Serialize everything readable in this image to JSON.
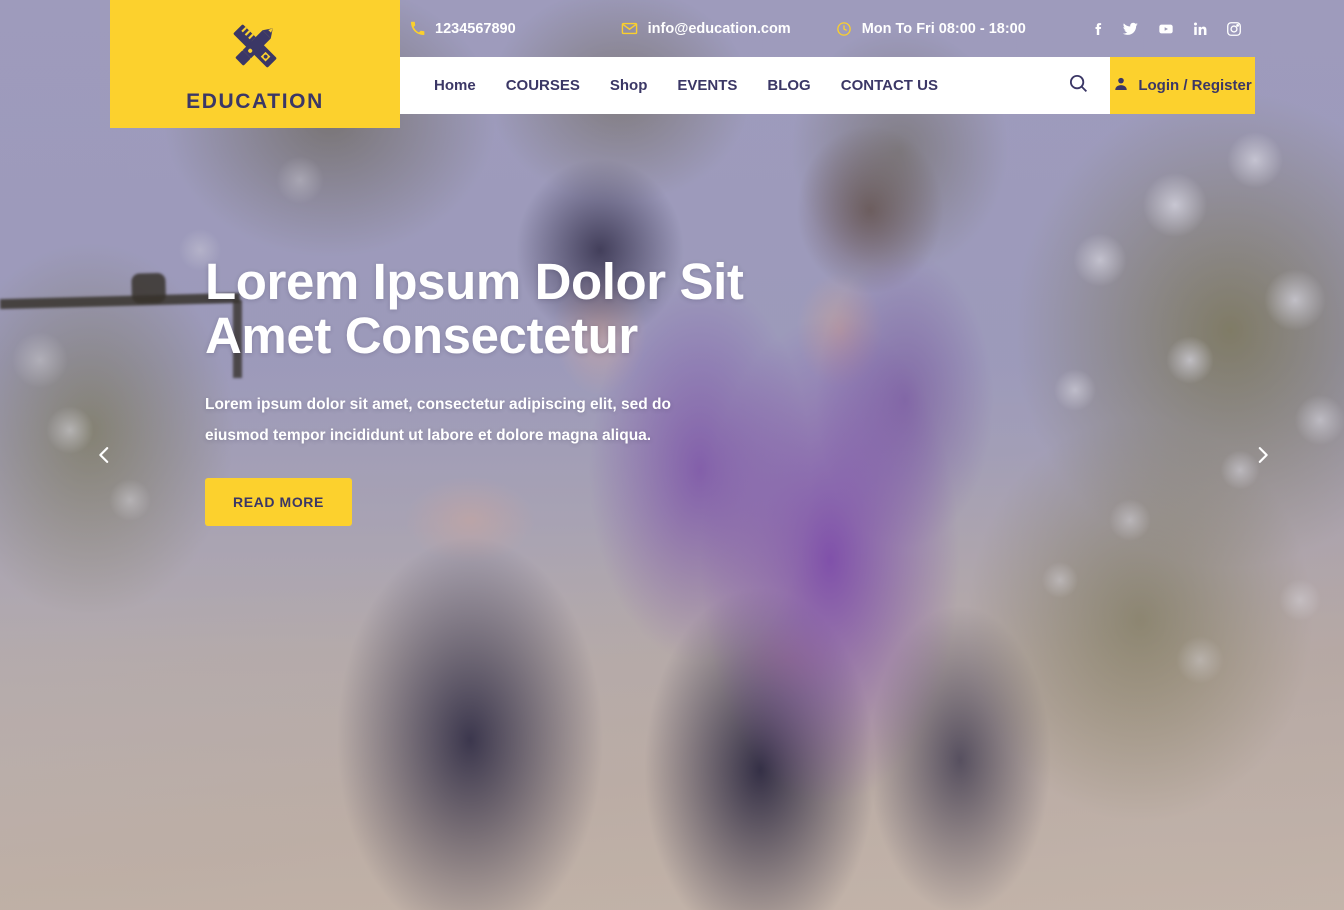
{
  "brand": {
    "name": "EDUCATION",
    "logo_icon": "ruler-pencil-icon",
    "accent_color": "#fcd12d",
    "navy_color": "#3b3766"
  },
  "topbar": {
    "phone": "1234567890",
    "phone_icon": "phone-icon",
    "email": "info@education.com",
    "email_icon": "envelope-icon",
    "hours": "Mon To Fri 08:00 - 18:00",
    "hours_icon": "clock-icon",
    "socials": [
      {
        "name": "facebook-icon",
        "label": "f"
      },
      {
        "name": "twitter-icon",
        "label": ""
      },
      {
        "name": "youtube-icon",
        "label": ""
      },
      {
        "name": "linkedin-icon",
        "label": "in"
      },
      {
        "name": "instagram-icon",
        "label": ""
      }
    ]
  },
  "nav": {
    "items": [
      {
        "label": "Home"
      },
      {
        "label": "COURSES"
      },
      {
        "label": "Shop"
      },
      {
        "label": "EVENTS"
      },
      {
        "label": "BLOG"
      },
      {
        "label": "CONTACT US"
      }
    ],
    "search_icon": "search-icon",
    "login": {
      "label": "Login / Register",
      "icon": "user-icon"
    }
  },
  "hero": {
    "title": "Lorem Ipsum Dolor Sit Amet Consectetur",
    "subtitle": "Lorem ipsum dolor sit amet, consectetur adipiscing elit, sed do eiusmod tempor incididunt ut labore et dolore magna aliqua.",
    "cta_label": "READ MORE",
    "prev_icon": "chevron-left-icon",
    "next_icon": "chevron-right-icon"
  }
}
